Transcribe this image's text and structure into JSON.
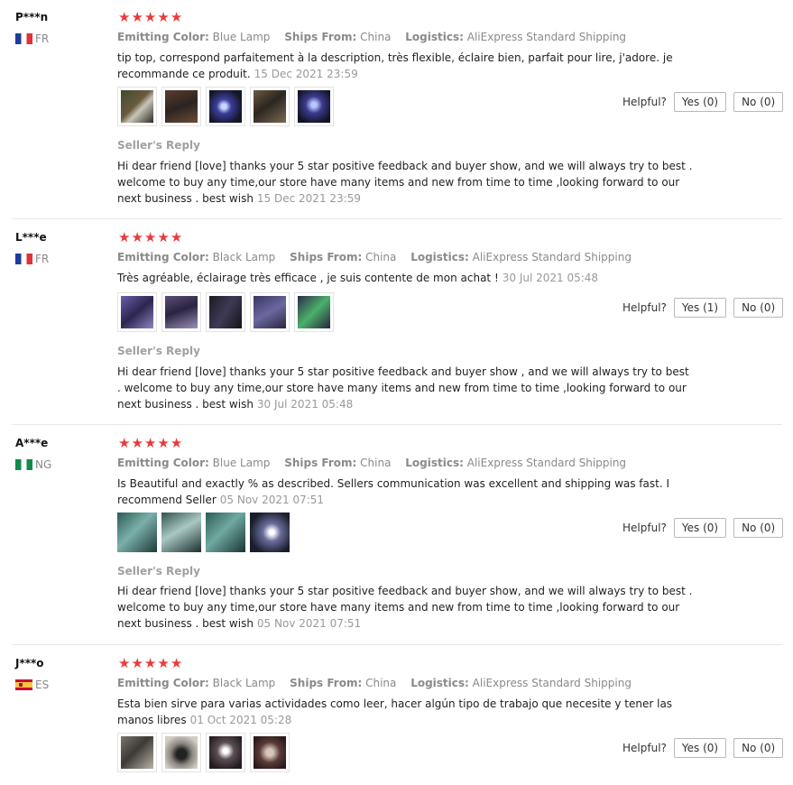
{
  "labels": {
    "emitting_color": "Emitting Color:",
    "ships_from": "Ships From:",
    "logistics": "Logistics:",
    "helpful": "Helpful?",
    "seller_reply": "Seller's Reply"
  },
  "colors": {
    "star": "#ea3a3c",
    "muted": "#8a8a8a"
  },
  "reviews": [
    {
      "user": "P***n",
      "country": "FR",
      "flag": "flag-fr-icon",
      "rating": 5,
      "emitting_color": "Blue Lamp",
      "ships_from": "China",
      "logistics": "AliExpress Standard Shipping",
      "text": "tip top, correspond parfaitement à la description, très flexible, éclaire bien, parfait pour lire, j'adore. je recommande ce produit.",
      "date": "15 Dec 2021 23:59",
      "photo_count": 5,
      "yes": "Yes (0)",
      "no": "No (0)",
      "reply": "Hi dear friend [love] thanks your 5 star positive feedback and buyer show, and we will always try to best . welcome to buy any time,our store have many items and new from time to time ,looking forward to our next business . best wish",
      "reply_date": "15 Dec 2021 23:59"
    },
    {
      "user": "L***e",
      "country": "FR",
      "flag": "flag-fr-icon",
      "rating": 5,
      "emitting_color": "Black Lamp",
      "ships_from": "China",
      "logistics": "AliExpress Standard Shipping",
      "text": "Très agréable, éclairage très efficace , je suis contente de mon achat !",
      "date": "30 Jul 2021 05:48",
      "photo_count": 5,
      "yes": "Yes (1)",
      "no": "No (0)",
      "reply": "Hi dear friend [love] thanks your 5 star positive feedback and buyer show , and we will always try to best . welcome to buy any time,our store have many items and new from time to time ,looking forward to our next business . best wish",
      "reply_date": "30 Jul 2021 05:48"
    },
    {
      "user": "A***e",
      "country": "NG",
      "flag": "flag-ng-icon",
      "rating": 5,
      "emitting_color": "Blue Lamp",
      "ships_from": "China",
      "logistics": "AliExpress Standard Shipping",
      "text": "Is Beautiful and exactly % as described. Sellers communication was excellent and shipping was fast. I recommend Seller",
      "date": "05 Nov 2021 07:51",
      "photo_count": 4,
      "yes": "Yes (0)",
      "no": "No (0)",
      "reply": "Hi dear friend [love] thanks your 5 star positive feedback and buyer show, and we will always try to best . welcome to buy any time,our store have many items and new from time to time ,looking forward to our next business . best wish",
      "reply_date": "05 Nov 2021 07:51"
    },
    {
      "user": "J***o",
      "country": "ES",
      "flag": "flag-es-icon",
      "rating": 5,
      "emitting_color": "Black Lamp",
      "ships_from": "China",
      "logistics": "AliExpress Standard Shipping",
      "text": "Esta bien sirve para varias actividades como leer, hacer algún tipo de trabajo que necesite y tener las manos libres",
      "date": "01 Oct 2021 05:28",
      "photo_count": 4,
      "yes": "Yes (0)",
      "no": "No (0)"
    }
  ]
}
